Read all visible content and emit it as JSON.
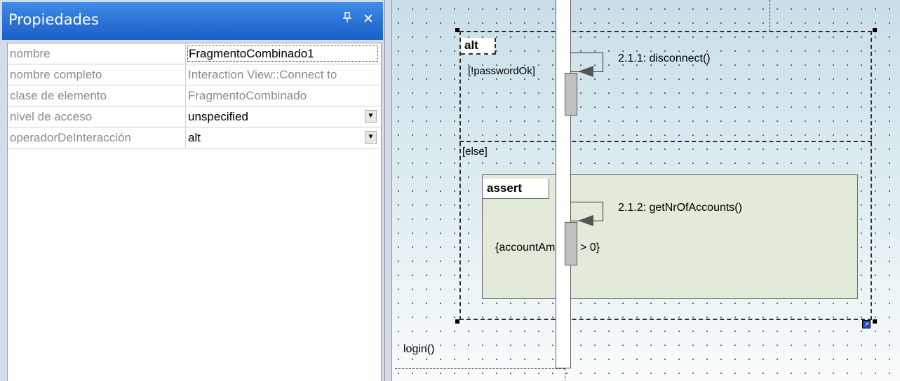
{
  "panel": {
    "title": "Propiedades",
    "pin_glyph": "ᵖ",
    "close_glyph": "✕",
    "properties": [
      {
        "name": "nombre",
        "value": "FragmentoCombinado1",
        "kind": "edit"
      },
      {
        "name": "nombre completo",
        "value": "Interaction View::Connect to",
        "kind": "readonly"
      },
      {
        "name": "clase de elemento",
        "value": "FragmentoCombinado",
        "kind": "readonly"
      },
      {
        "name": "nivel de acceso",
        "value": "unspecified",
        "kind": "dropdown"
      },
      {
        "name": "operadorDeInteracción",
        "value": "alt",
        "kind": "dropdown"
      }
    ]
  },
  "diagram": {
    "alt_label": "alt",
    "alt_guard": "[!passwordOk]",
    "else_guard": "[else]",
    "assert_label": "assert",
    "msg_disconnect": "2.1.1: disconnect()",
    "msg_getNr": "2.1.2: getNrOfAccounts()",
    "constraint": "{accountAmount > 0}",
    "login": "login()"
  },
  "colors": {
    "title_bar": "#2d74d6",
    "assert_fill": "#e2ead9",
    "panel_bg": "#d6dbe9"
  },
  "icons": {
    "pin": "pin-icon",
    "close": "close-icon",
    "dropdown": "chevron-down-icon",
    "resize": "resize-handle-icon"
  }
}
